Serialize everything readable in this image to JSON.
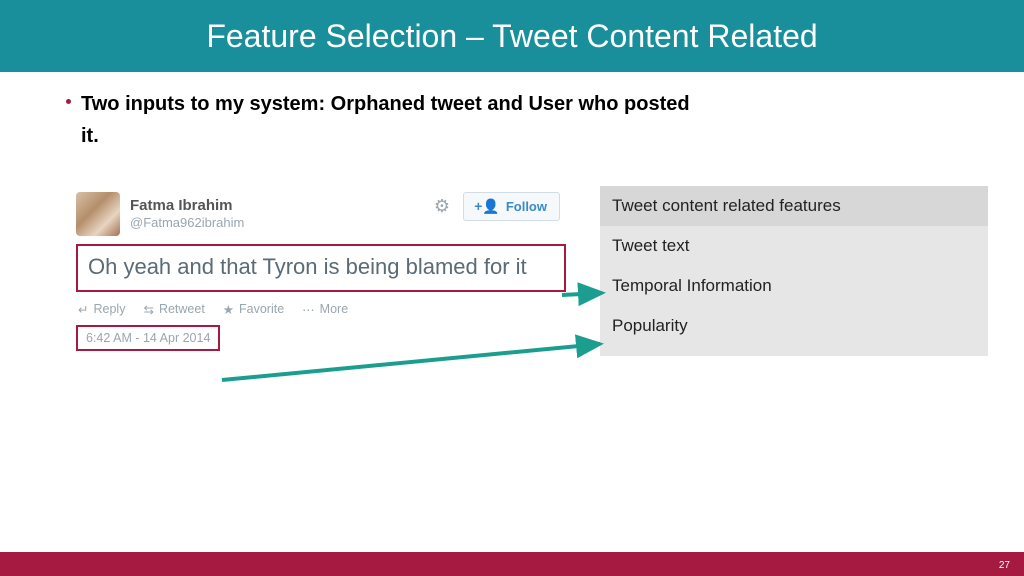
{
  "header": {
    "title": "Feature Selection – Tweet Content Related"
  },
  "bullet": {
    "text": "Two inputs to my system: Orphaned tweet and User who posted it."
  },
  "tweet": {
    "display_name": "Fatma Ibrahim",
    "handle": "@Fatma962ibrahim",
    "body": "Oh yeah and that Tyron is being blamed for it",
    "timestamp": "6:42 AM - 14 Apr 2014",
    "follow_label": "Follow",
    "actions": {
      "reply": "Reply",
      "retweet": "Retweet",
      "favorite": "Favorite",
      "more": "More"
    }
  },
  "features": {
    "title": "Tweet content related features",
    "items": [
      "Tweet text",
      "Temporal Information",
      "Popularity"
    ]
  },
  "page_number": "27"
}
